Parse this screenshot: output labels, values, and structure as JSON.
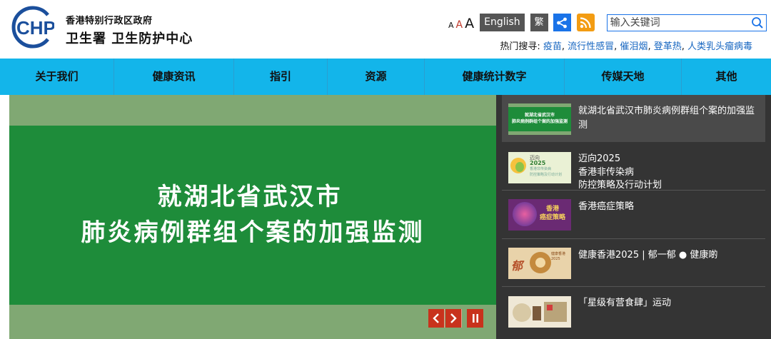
{
  "header": {
    "org_name": "香港特别行政区政府",
    "site_name": "卫生署  卫生防护中心",
    "logo_text": "CHP"
  },
  "tools": {
    "font_small": "A",
    "font_medium": "A",
    "font_large": "A",
    "english_label": "English",
    "traditional_label": "繁",
    "share_icon": "share-icon",
    "rss_icon": "rss-icon",
    "search_placeholder": "输入关键词"
  },
  "hot_search": {
    "label": "热门搜寻:",
    "links": [
      "疫苗",
      "流行性感冒",
      "催泪烟",
      "登革热",
      "人类乳头瘤病毒"
    ]
  },
  "nav": {
    "items": [
      "关于我们",
      "健康资讯",
      "指引",
      "资源",
      "健康统计数字",
      "传媒天地",
      "其他"
    ]
  },
  "hero": {
    "line1": "就湖北省武汉市",
    "line2": "肺炎病例群组个案的加强监测",
    "prev_icon": "chevron-left-icon",
    "next_icon": "chevron-right-icon",
    "pause_icon": "pause-icon"
  },
  "sidebar": {
    "items": [
      {
        "title": "就湖北省武汉市肺炎病例群组个案的加强监测",
        "thumb_line1": "就湖北省武汉市",
        "thumb_line2": "肺炎病例群组个案的加强监测"
      },
      {
        "title_lines": [
          "迈向2025",
          "香港非传染病",
          "防控策略及行动计划"
        ],
        "thumb_line1": "迈向",
        "thumb_line2": "2025",
        "thumb_line3": "香港非传染病",
        "thumb_line4": "防控策略及行动计划"
      },
      {
        "title": "香港癌症策略",
        "thumb_line1": "香港",
        "thumb_line2": "癌症策略"
      },
      {
        "title": "健康香港2025 | 郁一郁 ● 健康啲",
        "thumb_line1": "郁",
        "thumb_line2": "健康香港2025"
      },
      {
        "title": "「星级有营食肆」运动"
      }
    ]
  },
  "colors": {
    "nav_bg": "#13b5ea",
    "hero_green": "#1e8c3a",
    "hero_frame": "#80a873",
    "sidebar_bg": "#343434",
    "control_red": "#c8321c",
    "link_blue": "#1565c0"
  }
}
